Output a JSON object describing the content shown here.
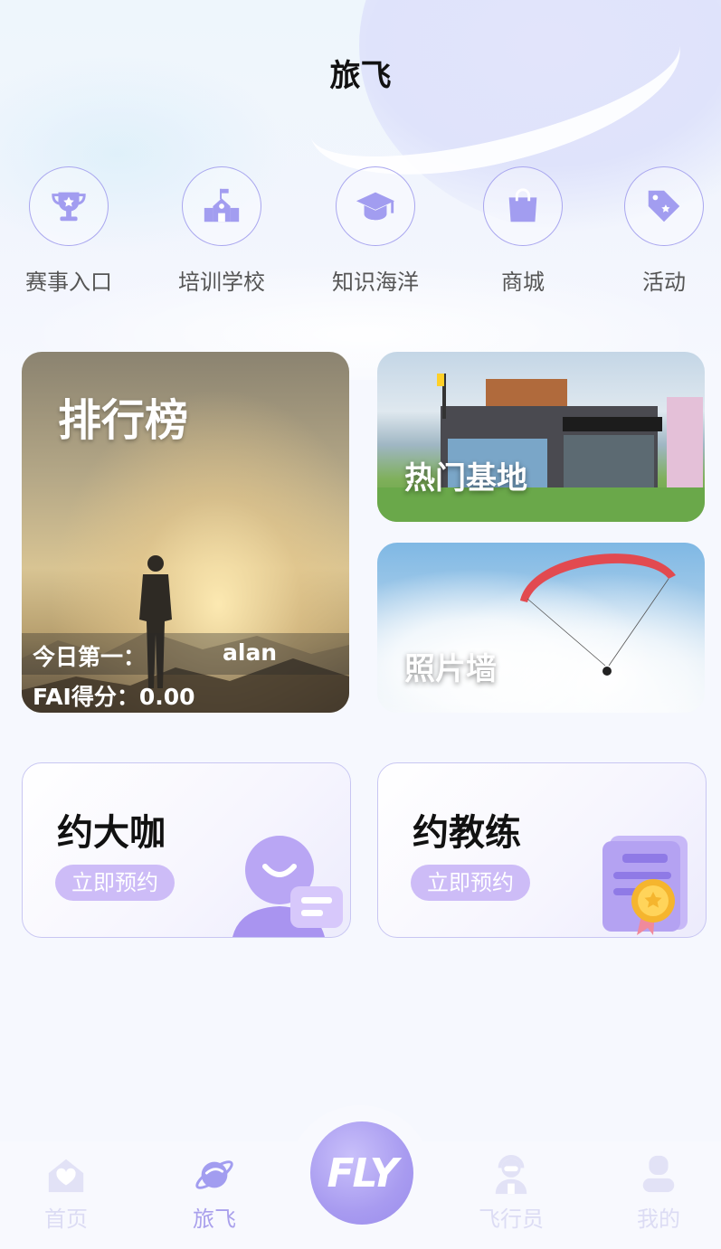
{
  "header": {
    "title": "旅飞"
  },
  "quick_nav": [
    {
      "label": "赛事入口",
      "icon": "trophy-icon"
    },
    {
      "label": "培训学校",
      "icon": "school-icon"
    },
    {
      "label": "知识海洋",
      "icon": "graduation-cap-icon"
    },
    {
      "label": "商城",
      "icon": "shopping-bag-icon"
    },
    {
      "label": "活动",
      "icon": "tag-icon"
    }
  ],
  "ranking": {
    "title": "排行榜",
    "first_label": "今日第一：",
    "first_name": "alan",
    "score_label": "FAI得分：0.00"
  },
  "hot_base": {
    "label": "热门基地"
  },
  "photo_wall": {
    "label": "照片墙"
  },
  "book_expert": {
    "title": "约大咖",
    "button": "立即预约"
  },
  "book_coach": {
    "title": "约教练",
    "button": "立即预约"
  },
  "tabbar": {
    "items": [
      {
        "label": "首页",
        "icon": "home-icon"
      },
      {
        "label": "旅飞",
        "icon": "planet-icon",
        "active": true
      },
      {
        "label": "FLY",
        "icon": "fly-logo-icon"
      },
      {
        "label": "飞行员",
        "icon": "pilot-icon"
      },
      {
        "label": "我的",
        "icon": "profile-icon"
      }
    ]
  },
  "colors": {
    "accent": "#a89bf0",
    "icon_fill": "#a29df0",
    "button_bg": "#cdbcf7"
  }
}
